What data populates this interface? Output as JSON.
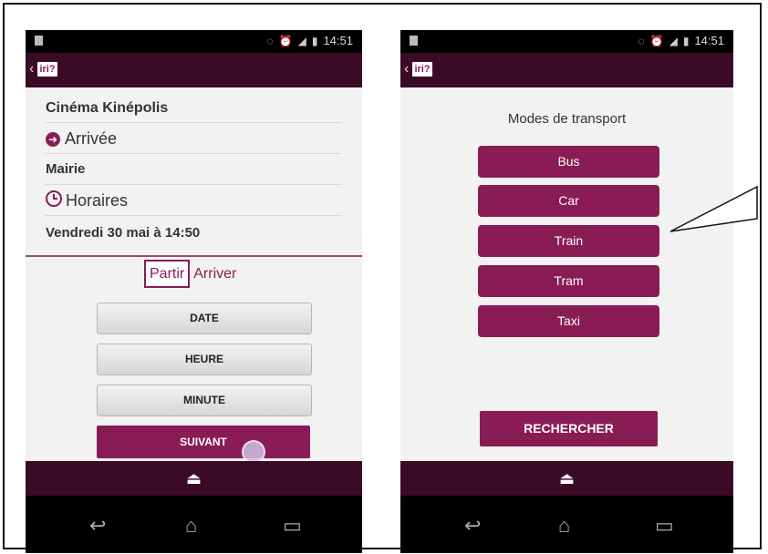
{
  "status_bar": {
    "time": "14:51",
    "time_left": "14:51"
  },
  "app": {
    "logo_text": "iri?"
  },
  "phone1": {
    "departure_name": "Cinéma Kinépolis",
    "arrival_label": "Arrivée",
    "arrival_name": "Mairie",
    "schedule_label": "Horaires",
    "schedule_value": "Vendredi 30 mai à 14:50",
    "toggle_selected": "Partir",
    "toggle_unselected": "Arriver",
    "buttons": [
      "DATE",
      "HEURE",
      "MINUTE"
    ],
    "next_button": "SUIVANT"
  },
  "phone2": {
    "title": "Modes de transport",
    "modes": [
      "Bus",
      "Car",
      "Train",
      "Tram",
      "Taxi"
    ],
    "search_button": "RECHERCHER"
  },
  "colors": {
    "accent": "#8a1c55",
    "appbar": "#3b0a24"
  },
  "icons": [
    "back-chevron-icon",
    "arrival-arrow-icon",
    "clock-icon",
    "eject-icon",
    "back-icon",
    "home-icon",
    "recents-icon"
  ]
}
